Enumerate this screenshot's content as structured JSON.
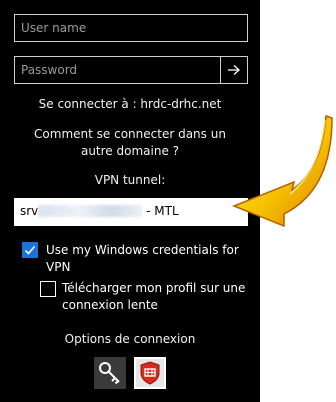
{
  "form": {
    "username_placeholder": "User name",
    "password_placeholder": "Password",
    "submit_icon": "arrow-right-icon",
    "connect_to": "Se connecter à : hrdc-drhc.net",
    "other_domain": "Comment se connecter dans un autre domaine ?",
    "vpn_label": "VPN tunnel:",
    "vpn_value_prefix": "srv",
    "vpn_value_suffix": "- MTL",
    "use_windows_credentials": {
      "label": "Use my Windows credentials for VPN",
      "checked": true
    },
    "slow_connection_profile": {
      "label": "Télécharger mon profil sur une connexion lente",
      "checked": false
    },
    "options_title": "Options de connexion",
    "options": [
      {
        "icon": "key-icon"
      },
      {
        "icon": "vpn-shield-icon"
      }
    ]
  },
  "colors": {
    "panel_bg": "#000000",
    "checkbox_blue": "#1a73d8",
    "arrow_yellow": "#f5c400",
    "shield_red": "#d52b1e"
  }
}
